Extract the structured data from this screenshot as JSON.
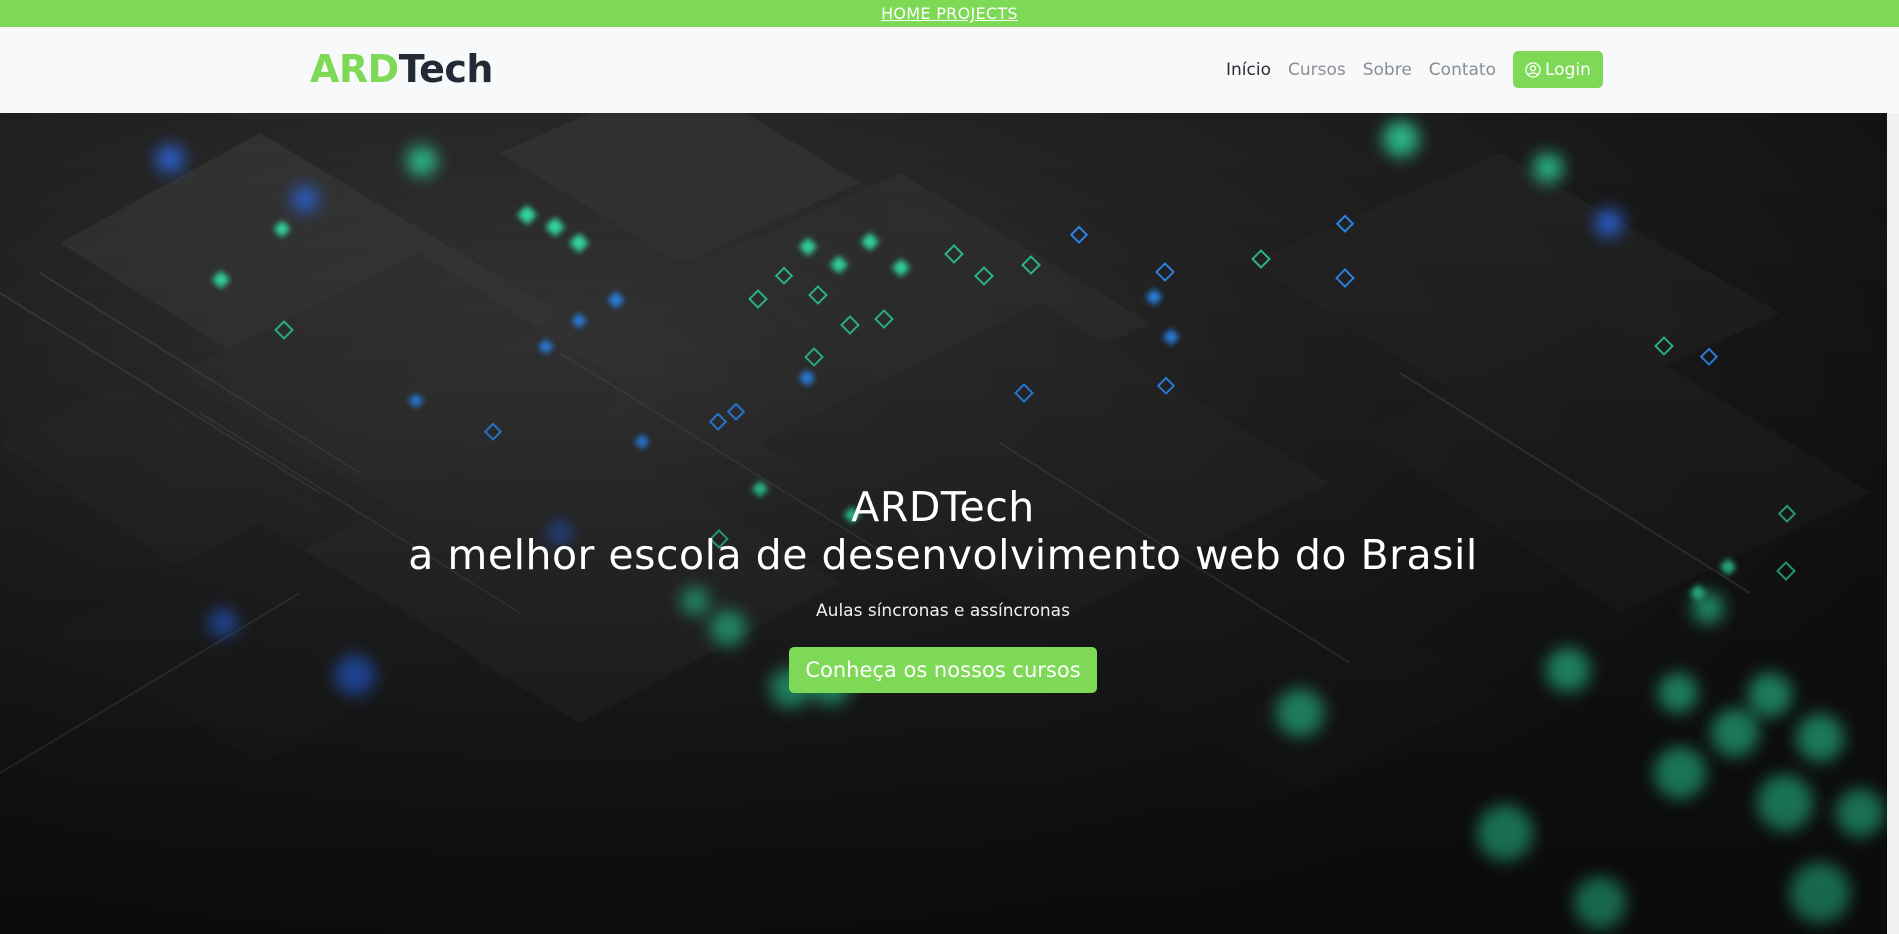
{
  "topbar": {
    "link_label": "HOME PROJECTS"
  },
  "brand": {
    "part1": "ARD",
    "part2": "Tech"
  },
  "nav": {
    "items": [
      "Início",
      "Cursos",
      "Sobre",
      "Contato"
    ],
    "login_label": "Login"
  },
  "hero": {
    "title_line1": "ARDTech",
    "title_line2": "a melhor escola de desenvolvimento web do Brasil",
    "subtitle": "Aulas síncronas e assíncronas",
    "cta_label": "Conheça os nossos cursos"
  },
  "colors": {
    "accent": "#7ed957",
    "navbar_bg": "#f7f9fa",
    "logo_dark": "#222a36"
  }
}
